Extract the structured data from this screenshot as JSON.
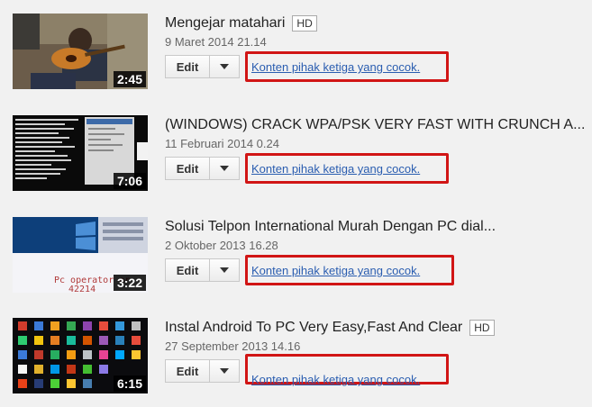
{
  "videos": [
    {
      "title": "Mengejar matahari",
      "hd": "HD",
      "date": "9 Maret 2014 21.14",
      "duration": "2:45",
      "edit_label": "Edit",
      "match_label": "Konten pihak ketiga yang cocok."
    },
    {
      "title": "(WINDOWS) CRACK WPA/PSK VERY FAST WITH CRUNCH A...",
      "hd": "",
      "date": "11 Februari 2014 0.24",
      "duration": "7:06",
      "edit_label": "Edit",
      "match_label": "Konten pihak ketiga yang cocok."
    },
    {
      "title": "Solusi Telpon International Murah Dengan PC dial...",
      "hd": "",
      "date": "2 Oktober 2013 16.28",
      "duration": "3:22",
      "edit_label": "Edit",
      "match_label": "Konten pihak ketiga yang cocok.",
      "thumb_text_1": "Pc operator or",
      "thumb_text_2": "42214"
    },
    {
      "title": "Instal Android To PC Very Easy,Fast And Clear",
      "hd": "HD",
      "date": "27 September 2013 14.16",
      "duration": "6:15",
      "edit_label": "Edit",
      "match_label": "Konten pihak ketiga yang cocok."
    }
  ],
  "colors": {
    "highlight": "#d11515",
    "link": "#2a5db0",
    "background": "#f1f1f1"
  }
}
